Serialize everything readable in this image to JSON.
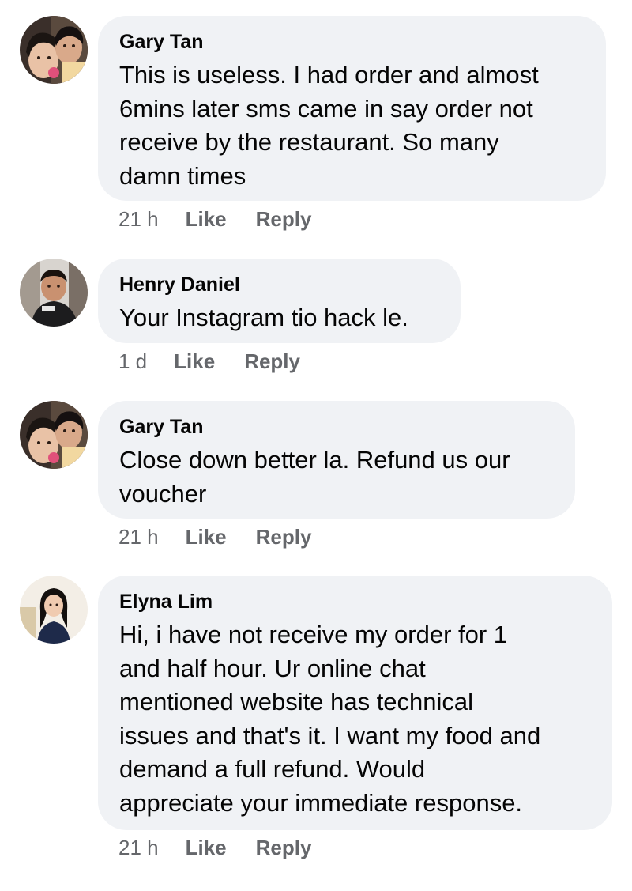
{
  "comments": [
    {
      "author": "Gary Tan",
      "text": "This is useless. I had order and almost\n6mins later sms came in say order not\nreceive by the restaurant. So many\ndamn times",
      "time": "21 h",
      "like_label": "Like",
      "reply_label": "Reply",
      "avatar_icon": "couple-selfie-avatar"
    },
    {
      "author": "Henry Daniel",
      "text": "Your Instagram tio hack le.",
      "time": "1 d",
      "like_label": "Like",
      "reply_label": "Reply",
      "avatar_icon": "man-portrait-avatar"
    },
    {
      "author": "Gary Tan",
      "text": "Close down better la. Refund us our\nvoucher",
      "time": "21 h",
      "like_label": "Like",
      "reply_label": "Reply",
      "avatar_icon": "couple-selfie-avatar"
    },
    {
      "author": "Elyna Lim",
      "text": "Hi, i have not receive my order for 1\nand half hour. Ur online chat\nmentioned website has technical\nissues and that's it. I want my food and\ndemand a full refund. Would\nappreciate your immediate response.",
      "time": "21 h",
      "like_label": "Like",
      "reply_label": "Reply",
      "avatar_icon": "woman-portrait-avatar"
    }
  ],
  "colors": {
    "bubble_background": "#f0f2f5",
    "primary_text": "#050505",
    "secondary_text": "#65676b"
  }
}
